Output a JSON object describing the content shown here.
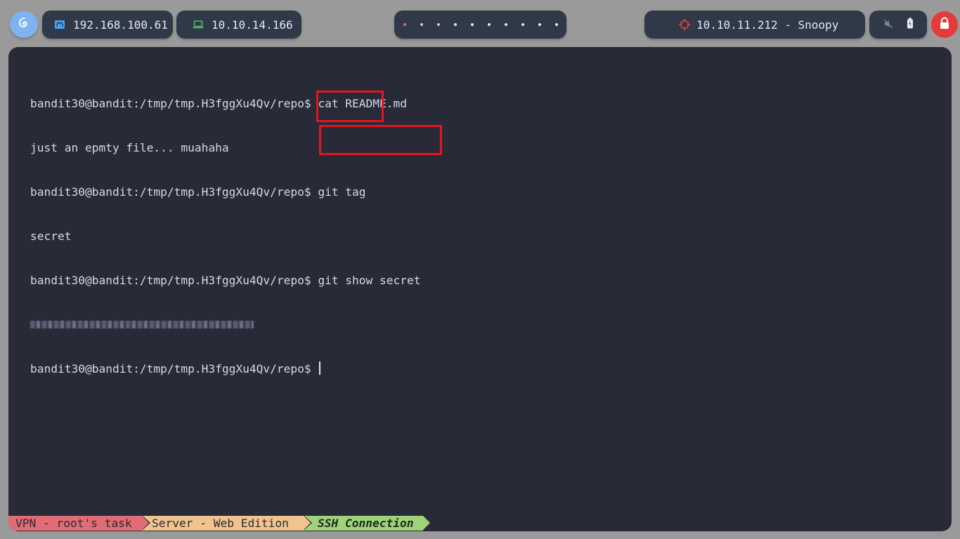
{
  "topbar": {
    "logo_icon": "debian-swirl-icon",
    "host_ip": "192.168.100.61",
    "vpn_ip": "10.10.14.166",
    "workspaces": [
      {
        "color": "#e06c75"
      },
      {
        "color": "#f0c38f"
      },
      {
        "color": "#f0c38f"
      },
      {
        "color": "#e6e8ee"
      },
      {
        "color": "#e6e8ee"
      },
      {
        "color": "#e6e8ee"
      },
      {
        "color": "#e6e8ee"
      },
      {
        "color": "#e6e8ee"
      },
      {
        "color": "#e6e8ee"
      },
      {
        "color": "#e6e8ee"
      }
    ],
    "target": "10.10.11.212 - Snoopy",
    "colors": {
      "target_icon": "#e53a3a",
      "host_icon": "#4aa3f0",
      "vpn_icon": "#4cc26e",
      "lock_bg": "#e53a3a"
    }
  },
  "terminal": {
    "lines": [
      {
        "prompt": "bandit30@bandit:/tmp/tmp.H3fggXu4Qv/repo$",
        "cmd": " cat README.md"
      },
      {
        "output": "just an epmty file... muahaha"
      },
      {
        "prompt": "bandit30@bandit:/tmp/tmp.H3fggXu4Qv/repo$",
        "cmd": " git tag"
      },
      {
        "output": "secret"
      },
      {
        "prompt": "bandit30@bandit:/tmp/tmp.H3fggXu4Qv/repo$",
        "cmd": " git show secret"
      },
      {
        "redacted": true
      },
      {
        "prompt": "bandit30@bandit:/tmp/tmp.H3fggXu4Qv/repo$",
        "cmd": " "
      }
    ]
  },
  "statusbar": {
    "segments": [
      {
        "label": "VPN - root's task",
        "color": "#e06c75"
      },
      {
        "label": "Server - Web Edition",
        "color": "#f0c38f"
      },
      {
        "label": "SSH Connection",
        "color": "#9ed37a"
      }
    ]
  }
}
